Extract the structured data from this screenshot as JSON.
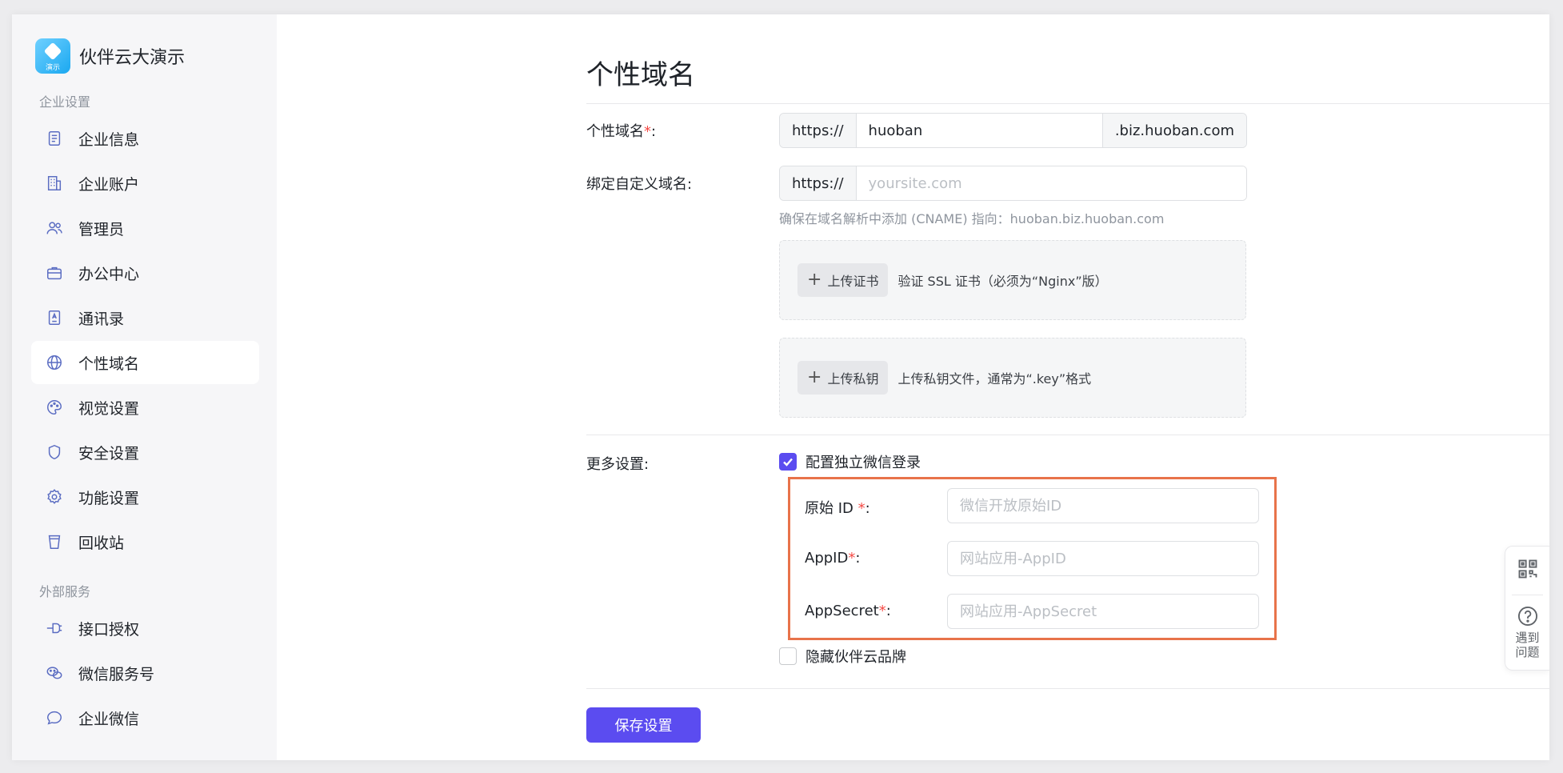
{
  "brand": {
    "name": "伙伴云大演示",
    "logo_tag": "演示"
  },
  "sidebar": {
    "group_enterprise": "企业设置",
    "group_external": "外部服务",
    "enterprise_items": [
      {
        "label": "企业信息",
        "icon": "document-icon"
      },
      {
        "label": "企业账户",
        "icon": "building-icon"
      },
      {
        "label": "管理员",
        "icon": "users-icon"
      },
      {
        "label": "办公中心",
        "icon": "briefcase-icon"
      },
      {
        "label": "通讯录",
        "icon": "contacts-book-icon"
      },
      {
        "label": "个性域名",
        "icon": "globe-icon",
        "active": true
      },
      {
        "label": "视觉设置",
        "icon": "palette-icon"
      },
      {
        "label": "安全设置",
        "icon": "shield-icon"
      },
      {
        "label": "功能设置",
        "icon": "gear-icon"
      },
      {
        "label": "回收站",
        "icon": "trash-cup-icon"
      }
    ],
    "external_items": [
      {
        "label": "接口授权",
        "icon": "plug-icon"
      },
      {
        "label": "微信服务号",
        "icon": "wechat-icon"
      },
      {
        "label": "企业微信",
        "icon": "chat-bubble-icon"
      }
    ]
  },
  "main": {
    "title": "个性域名",
    "domain": {
      "label": "个性域名",
      "colon": ":",
      "prefix": "https://",
      "value": "huoban",
      "suffix": ".biz.huoban.com"
    },
    "custom_domain": {
      "label": "绑定自定义域名:",
      "prefix": "https://",
      "placeholder": "yoursite.com",
      "hint": "确保在域名解析中添加 (CNAME) 指向：huoban.biz.huoban.com"
    },
    "ssl_upload": {
      "button": "上传证书",
      "desc": "验证 SSL 证书（必须为“Nginx”版）"
    },
    "key_upload": {
      "button": "上传私钥",
      "desc": "上传私钥文件，通常为“.key”格式"
    },
    "more": {
      "label": "更多设置:",
      "wechat_login": {
        "label": "配置独立微信登录",
        "checked": true
      },
      "fields": {
        "origin_id": {
          "label": "原始 ID",
          "placeholder": "微信开放原始ID"
        },
        "app_id": {
          "label": "AppID",
          "placeholder": "网站应用-AppID"
        },
        "app_secret": {
          "label": "AppSecret",
          "placeholder": "网站应用-AppSecret"
        }
      },
      "hide_brand": {
        "label": "隐藏伙伴云品牌",
        "checked": false
      }
    },
    "save_label": "保存设置"
  },
  "float_panel": {
    "help_label": "遇到问题",
    "qr_icon": "qr-code-icon",
    "help_icon": "question-circle-icon"
  },
  "colors": {
    "accent": "#5b4cf0",
    "highlight_border": "#e8734a",
    "required": "#f54a45"
  }
}
